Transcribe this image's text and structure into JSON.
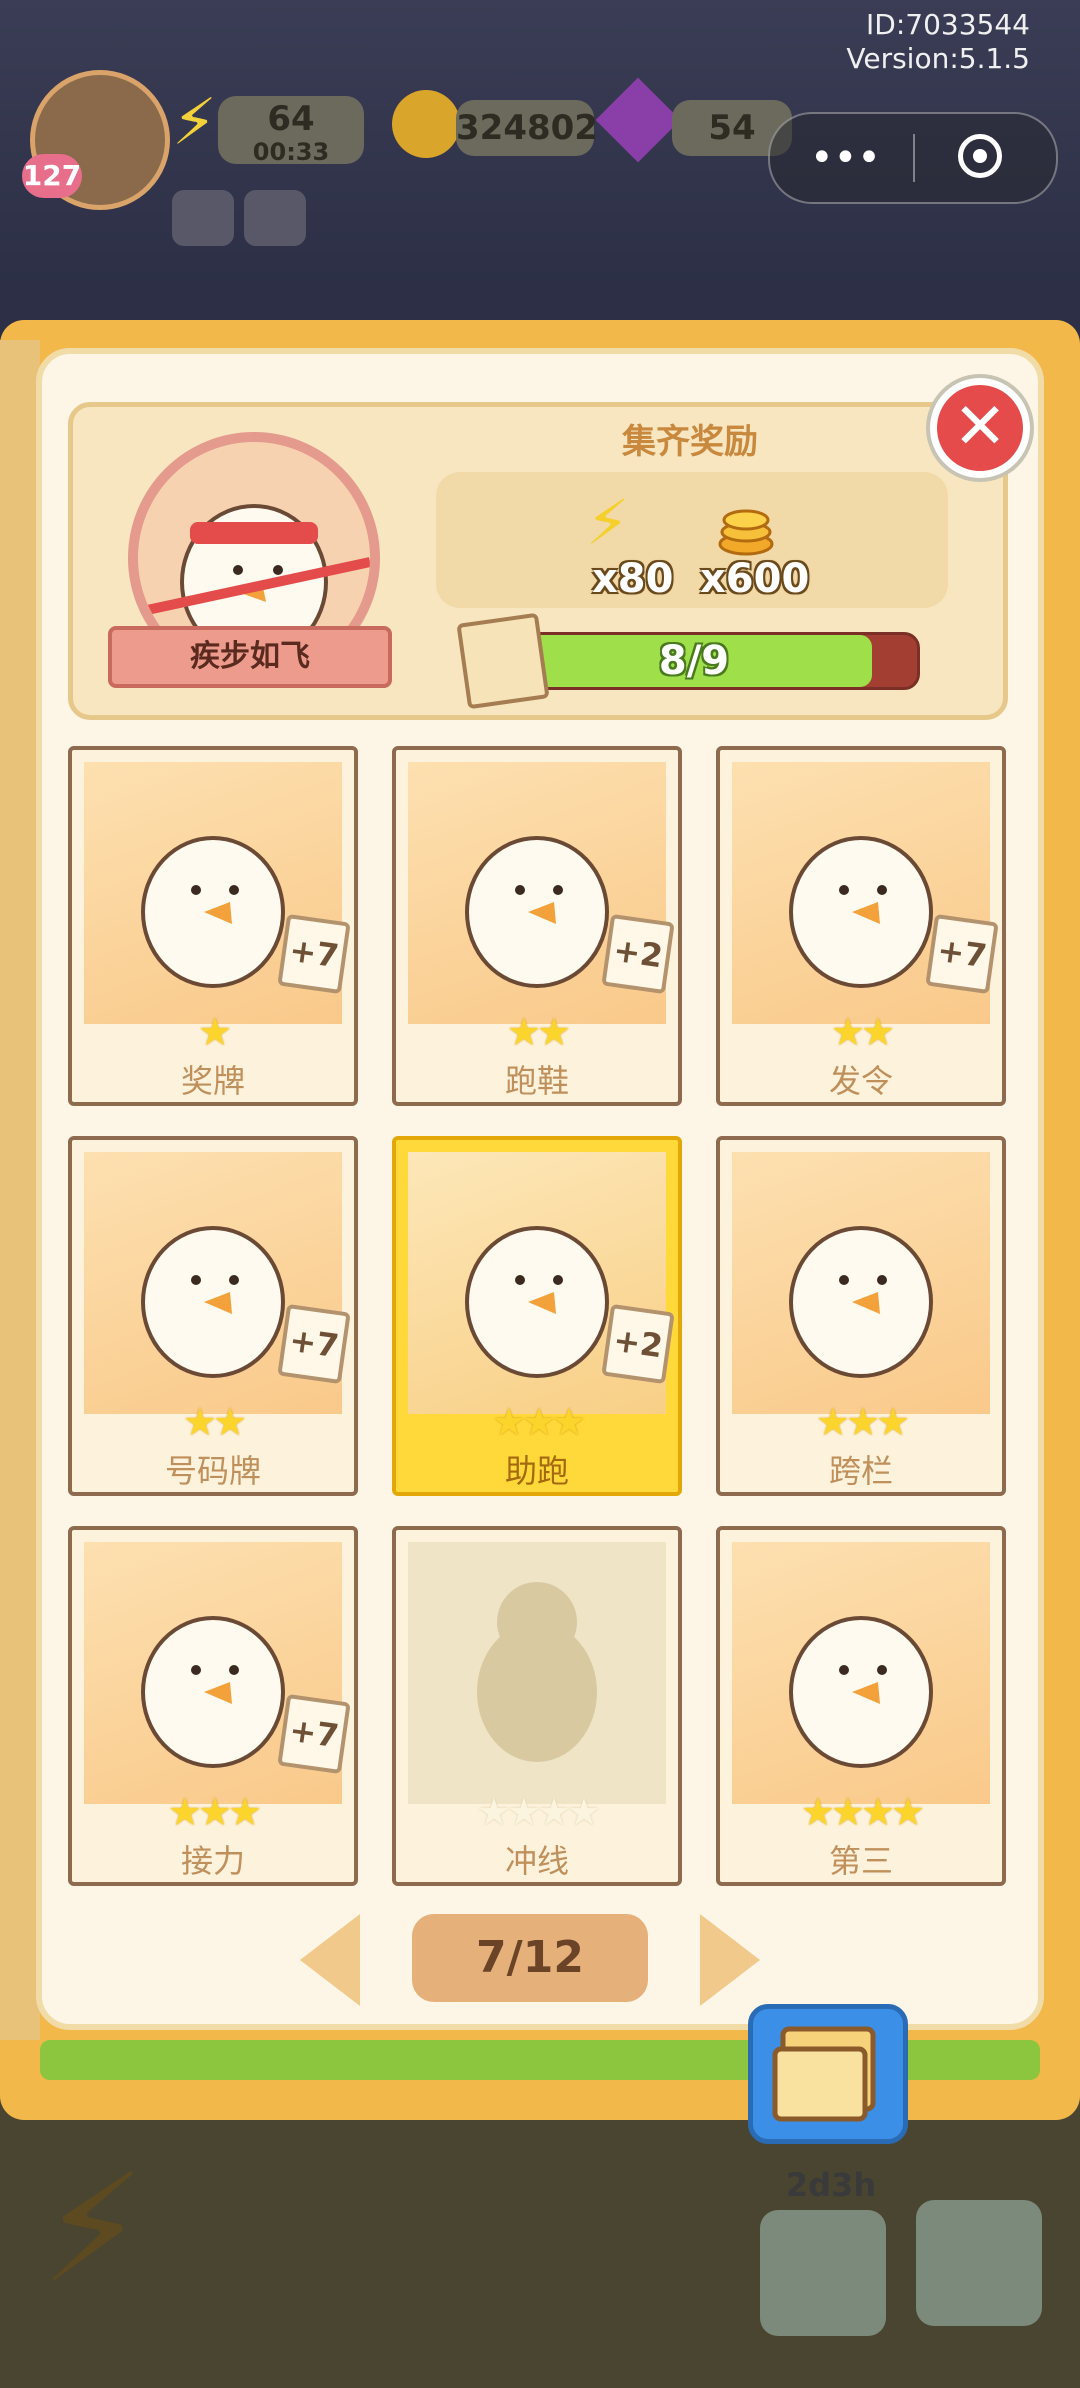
{
  "status": {
    "id_text": "ID:7033544",
    "version_text": "Version:5.1.5"
  },
  "topbar": {
    "level": "127",
    "energy": "64",
    "energy_timer": "00:33",
    "coins": "324802",
    "gems": "54"
  },
  "collection": {
    "avatar_label": "疾步如飞",
    "reward_title": "集齐奖励",
    "rewards": [
      {
        "icon": "lightning-icon",
        "label": "x80"
      },
      {
        "icon": "coins-icon",
        "label": "x600"
      }
    ],
    "progress_text": "8/9",
    "progress_value": 0.889
  },
  "cards": [
    {
      "name": "奖牌",
      "stars": "★",
      "badge": "+7",
      "highlighted": false,
      "locked": false
    },
    {
      "name": "跑鞋",
      "stars": "★★",
      "badge": "+2",
      "highlighted": false,
      "locked": false
    },
    {
      "name": "发令",
      "stars": "★★",
      "badge": "+7",
      "highlighted": false,
      "locked": false
    },
    {
      "name": "号码牌",
      "stars": "★★",
      "badge": "+7",
      "highlighted": false,
      "locked": false
    },
    {
      "name": "助跑",
      "stars": "★★★",
      "badge": "+2",
      "highlighted": true,
      "locked": false
    },
    {
      "name": "跨栏",
      "stars": "★★★",
      "badge": "",
      "highlighted": false,
      "locked": false
    },
    {
      "name": "接力",
      "stars": "★★★",
      "badge": "+7",
      "highlighted": false,
      "locked": false
    },
    {
      "name": "冲线",
      "stars": "★★★★",
      "badge": "",
      "highlighted": false,
      "locked": true
    },
    {
      "name": "第三",
      "stars": "★★★★",
      "badge": "",
      "highlighted": false,
      "locked": false
    }
  ],
  "pagination": {
    "text": "7/12"
  },
  "bottom": {
    "timer": "2d3h"
  }
}
